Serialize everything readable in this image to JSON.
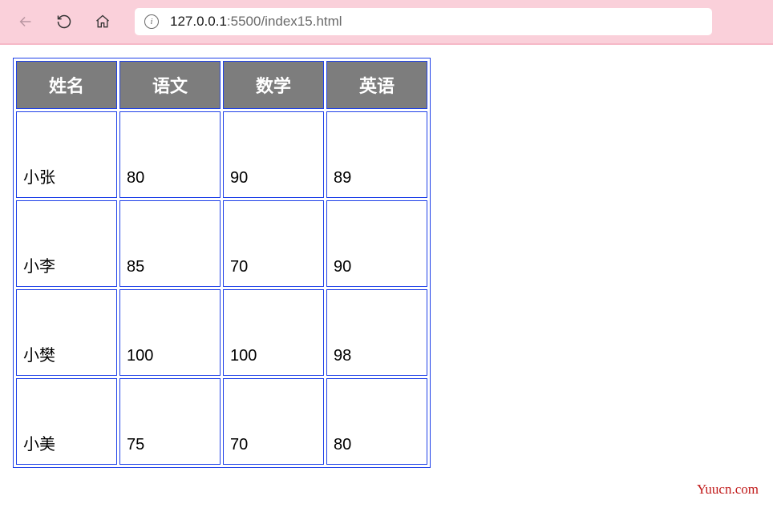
{
  "browser": {
    "url_host": "127.0.0.1",
    "url_path": ":5500/index15.html"
  },
  "table": {
    "headers": [
      "姓名",
      "语文",
      "数学",
      "英语"
    ],
    "rows": [
      {
        "name": "小张",
        "chinese": "80",
        "math": "90",
        "english": "89"
      },
      {
        "name": "小李",
        "chinese": "85",
        "math": "70",
        "english": "90"
      },
      {
        "name": "小樊",
        "chinese": "100",
        "math": "100",
        "english": "98"
      },
      {
        "name": "小美",
        "chinese": "75",
        "math": "70",
        "english": "80"
      }
    ]
  },
  "watermark": "Yuucn.com"
}
